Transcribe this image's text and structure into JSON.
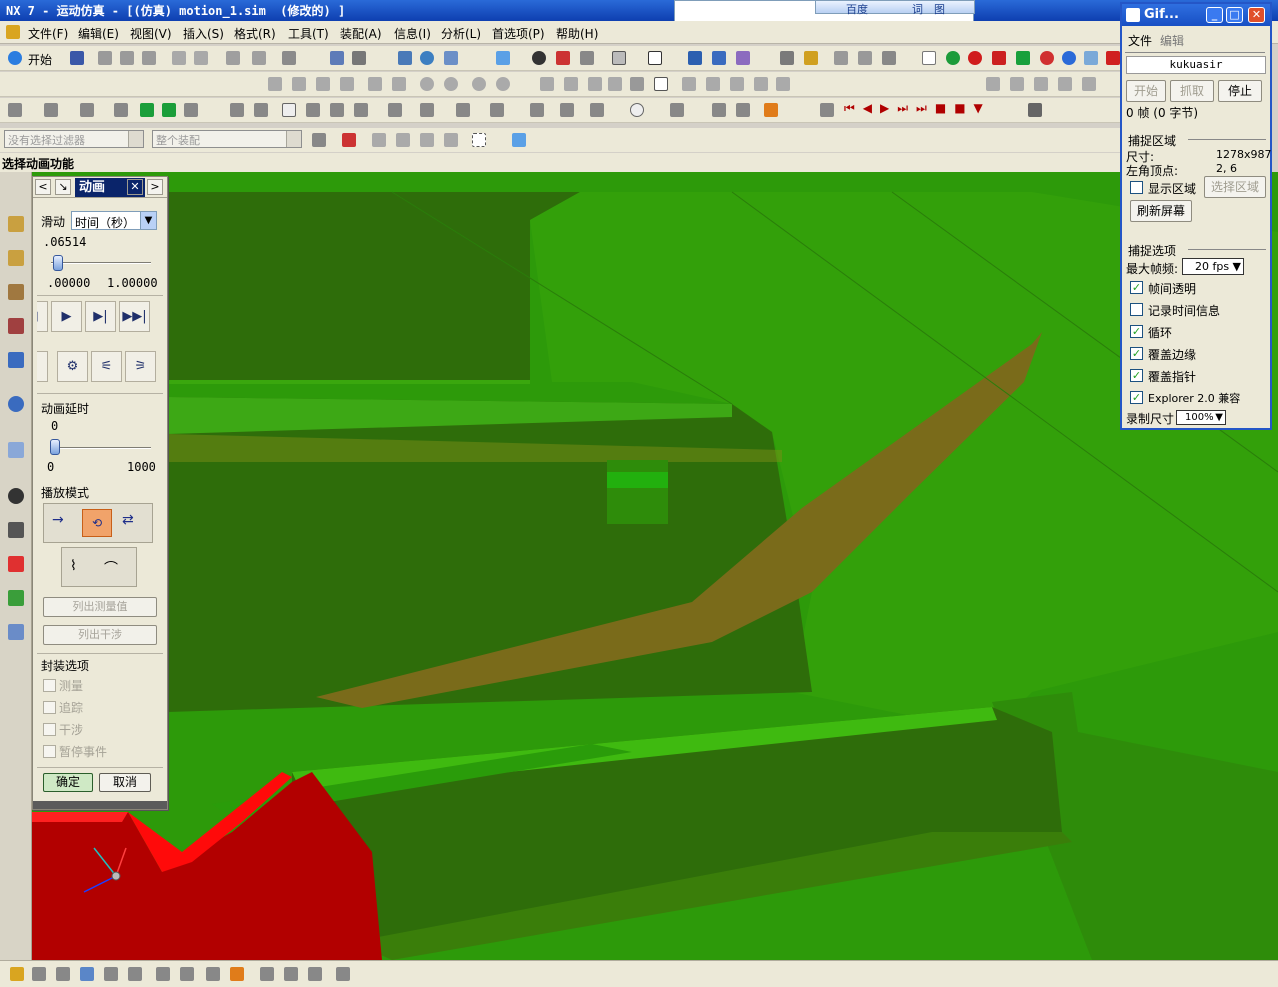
{
  "window": {
    "title": "NX 7 - 运动仿真 - [(仿真) motion_1.sim  (修改的) ]"
  },
  "menu": [
    "文件(F)",
    "编辑(E)",
    "视图(V)",
    "插入(S)",
    "格式(R)",
    "工具(T)",
    "装配(A)",
    "信息(I)",
    "分析(L)",
    "首选项(P)",
    "帮助(H)"
  ],
  "toolbar": {
    "start_label": "开始"
  },
  "selection": {
    "filter_placeholder": "没有选择过滤器",
    "scope_placeholder": "整个装配"
  },
  "cue_line": "选择动画功能",
  "browser_popup": {
    "tabs": [
      "百度",
      "词",
      "图"
    ]
  },
  "dialog": {
    "title": "动画",
    "slide_label": "滑动",
    "slide_mode": "时间（秒）",
    "current_value": ".06514",
    "slider_fraction": 0.065,
    "range_min": ".00000",
    "range_max": "1.00000",
    "delay_label": "动画延时",
    "delay_value": "0",
    "delay_min": "0",
    "delay_max": "1000",
    "playmode_label": "播放模式",
    "list_measure": "列出测量值",
    "list_interference": "列出干涉",
    "package_label": "封装选项",
    "options": [
      "测量",
      "追踪",
      "干涉",
      "暂停事件"
    ],
    "ok": "确定",
    "cancel": "取消"
  },
  "gif": {
    "title": "Gif...",
    "menu": [
      "文件",
      "编辑"
    ],
    "user": "kukuasir",
    "btn_start": "开始",
    "btn_capture": "抓取",
    "btn_stop": "停止",
    "frames": "0 帧 (0 字节)",
    "capture_area": "捕捉区域",
    "size_label": "尺寸:",
    "size_value": "1278x987",
    "corner_label": "左角顶点:",
    "corner_value": "2, 6",
    "show_area": "显示区域",
    "select_area": "选择区域",
    "refresh": "刷新屏幕",
    "capture_options": "捕捉选项",
    "max_fps_label": "最大帧频:",
    "max_fps_value": "20 fps",
    "opt_transparent": "帧间透明",
    "opt_time": "记录时间信息",
    "opt_loop": "循环",
    "opt_cover_edge": "覆盖边缘",
    "opt_cover_pointer": "覆盖指针",
    "opt_explorer": "Explorer 2.0 兼容",
    "rec_size_label": "录制尺寸",
    "rec_size_value": "100%"
  },
  "colors": {
    "viewport_green": "#2d9a0a",
    "dark_green": "#2e6d0a",
    "red_part": "#b20000",
    "title_blue": "#0a246a"
  }
}
